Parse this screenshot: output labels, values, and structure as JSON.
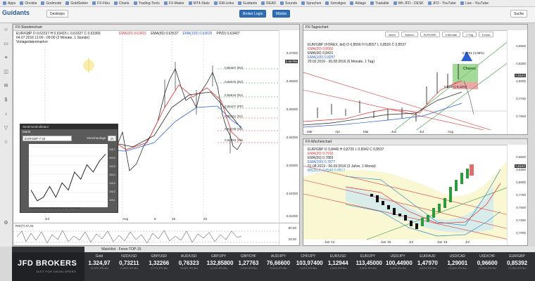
{
  "bookmarks": [
    "Apps",
    "Onvista",
    "Godmode",
    "GoldSeiten",
    "FX-Fibu",
    "Charts",
    "Trading-Tools",
    "FX-Maker",
    "MT4-Stats",
    "GM-Links",
    "Guidants",
    "READ",
    "Sounds",
    "Sprachen",
    "Sonstiges",
    "Ablage",
    "Tradable",
    "Wh JFD - DESK",
    "JFD - YouTube",
    "Live - YouTube"
  ],
  "app": {
    "logo": "Guidants",
    "desktops": "Desktops",
    "broker_login": "Broker Login",
    "markets": "Märkte",
    "search": "Suche"
  },
  "left_panel": {
    "title": "FX-Stundenchart",
    "legend": [
      "EUR/GBP  O 0,63327  H 0,63415  L 0,63327  C 0,63366",
      "04.07.2016 11:00 - 09:00 (2 Monate, 1 Stunde)",
      "Vorlagedatenmarker"
    ],
    "ema_legend": [
      "EMA(20) 0,63431",
      "EMA(50) 0,63537",
      "EMA(100) 0,63635",
      "PP(D) 0,63407"
    ],
    "price_ticks": [
      "0,67000",
      "0,66000",
      "0,65000",
      "0,64000",
      "0,63000",
      "0,62000",
      "0,61000"
    ],
    "current_price": "0,65786",
    "levels": [
      "0,86487 (R3)",
      "0,86075 (R2)",
      "0,85819 (R1)",
      "0,85407 (PP)",
      "0,85151 (S1)",
      "0,84739 (S2)",
      "0,84483 (S3)"
    ],
    "x_labels": [
      "Jul",
      "Aug",
      "8",
      "15",
      "22"
    ],
    "rsi_title": "RSI(7) 47,01",
    "rsi_ticks": [
      "80,00",
      "20,00"
    ]
  },
  "mini_chart": {
    "title": "Sentimentindikator",
    "field_label": "Markt",
    "symbol": "EURGBP-7-22",
    "period_label": "Vorschaufage",
    "period_value": "20",
    "y_ticks": [
      "100,7",
      "100,6",
      "100,5",
      "100,4",
      "100,3",
      "100,2",
      "100,1"
    ],
    "x_labels": "Aug 28 Sep 01 Sep 04 Sep 08 Sep 12 Sep 16 Sep 22",
    "values": [
      100.2,
      100.05,
      100.1,
      100.25,
      100.1,
      100.3,
      100.2,
      100.45,
      100.35,
      100.55,
      100.45,
      100.6,
      100.7
    ]
  },
  "top_right_panel": {
    "title": "FX-Tageschart",
    "toolbar": [
      "Ideen",
      "Notizen",
      "EUR/GBP",
      "6 Monate",
      "1 Tag",
      "Extras"
    ],
    "legend": [
      "EUR/GBP (FOREX, bid) O 0,8556 H 0,8557 L 0,8526 C 0,8537",
      "EMA(20) 0,8560",
      "EMA(50) 0,8431",
      "EMA(100) 0,8257",
      "29.02.2016 - 26.08.2016 (6 Monate, 1 Tag)"
    ],
    "annotations": [
      "0,8701 (4,05%)",
      "Chance",
      "0,8100 (-5,11%)"
    ],
    "price_ticks": [
      "0,8500",
      "0,8250",
      "0,8000",
      "0,7750",
      "0,7500"
    ],
    "current_price": "0,8540",
    "x_labels": [
      "Mär",
      "Apr",
      "Mai",
      "Jun",
      "Jul",
      "Aug"
    ]
  },
  "bottom_right_panel": {
    "title": "FX-Wochenchart",
    "legend": [
      "EUR/GBP  O 0,8440  H 0,8725  L 0,8342  C 0,8537",
      "EMA(20) 0,7916",
      "EMA(50) 0,7883",
      "EMA(100) 0,7877",
      "01.08.2013 - 06.09.2016 (3 Jahre, 1 Monat)",
      "BB(20,2) 0,8549 0,8812"
    ],
    "price_ticks": [
      "0,8500",
      "0,8250",
      "0,8000",
      "0,7750",
      "0,7500",
      "0,7250",
      "0,7000"
    ],
    "current_price": "0,8540",
    "x_labels": [
      "Jan '14",
      "Jan '15",
      "Jul",
      "Jan '16",
      "Jul"
    ]
  },
  "watchlist": {
    "title": "Watchlist",
    "tab_name": "Forex-TOP-15",
    "broker": "JFD BROKERS",
    "tagline": "JUST FOR DEVELOPERS",
    "quotes": [
      {
        "symbol": "Gold",
        "price": "1.324,97",
        "foot": "+0,12%  JFD Bro"
      },
      {
        "symbol": "NZD/USD",
        "price": "0,73211",
        "foot": "+0,15%  JFD Bro"
      },
      {
        "symbol": "GBP/USD",
        "price": "1,32266",
        "foot": "-0,17%  JFD Bro"
      },
      {
        "symbol": "AUD/USD",
        "price": "0,76323",
        "foot": "+0,05%  JFD Bro"
      },
      {
        "symbol": "GBP/JPY",
        "price": "132,85800",
        "foot": "-0,21%  JFD Bro"
      },
      {
        "symbol": "GBP/CHF",
        "price": "1,27763",
        "foot": "-0,19%  JFD Bro"
      },
      {
        "symbol": "AUD/JPY",
        "price": "76,66600",
        "foot": "+0,04%  JFD Bro"
      },
      {
        "symbol": "CHF/JPY",
        "price": "103,97400",
        "foot": "-0,03%  JFD Bro"
      },
      {
        "symbol": "EUR/USD",
        "price": "1,12944",
        "foot": "-0,02%  JFD Bro"
      },
      {
        "symbol": "EUR/JPY",
        "price": "113,45000",
        "foot": "-0,06%  JFD Bro"
      },
      {
        "symbol": "USD/JPY",
        "price": "100,44900",
        "foot": "-0,05%  JFD Bro"
      },
      {
        "symbol": "EUR/AUD",
        "price": "1,47970",
        "foot": "-0,07%  JFD Bro"
      },
      {
        "symbol": "USD/CAD",
        "price": "1,29001",
        "foot": "+0,01%  JFD Bro"
      },
      {
        "symbol": "USD/CHF",
        "price": "0,96600",
        "foot": "+0,02%  JFD Bro"
      },
      {
        "symbol": "EUR/GBP",
        "price": "0,85392",
        "foot": "+0,15%  JFD Bro"
      }
    ]
  },
  "colors": {
    "ema20": "#e0322e",
    "ema50": "#222222",
    "ema100": "#2a5fd1",
    "up": "#2c9a3b",
    "down": "#111111"
  }
}
